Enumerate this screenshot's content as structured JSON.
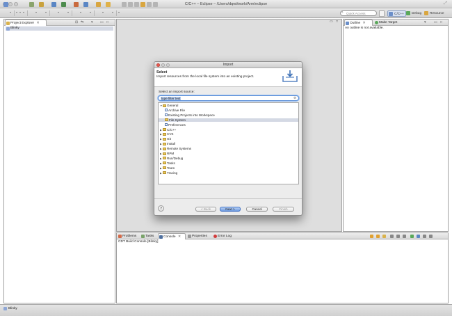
{
  "window": {
    "title": "C/C++ – Eclipse – /Users/dqwt/work/Arm/eclipse"
  },
  "toolbar": {
    "quick_access_placeholder": "Quick Access",
    "perspectives": [
      {
        "label": "C/C++",
        "active": true,
        "color": "#6b8fc9"
      },
      {
        "label": "Debug",
        "active": false,
        "color": "#5aa85a"
      },
      {
        "label": "Resource",
        "active": false,
        "color": "#d9a640"
      }
    ]
  },
  "project_explorer": {
    "tab_label": "Project Explorer",
    "items": [
      "Blinky"
    ]
  },
  "outline": {
    "tabs": [
      "Outline",
      "Make Target"
    ],
    "message": "An outline is not available."
  },
  "bottom_panel": {
    "tabs": [
      "Problems",
      "Tasks",
      "Console",
      "Properties",
      "Error Log"
    ],
    "console_title": "CDT Build Console [Blinky]"
  },
  "status_bar": {
    "text": "Blinky"
  },
  "dialog": {
    "title": "Import",
    "header_title": "Select",
    "header_desc": "Import resources from the local file system into an existing project.",
    "source_label": "Select an import source:",
    "filter_value": "type filter text",
    "tree": [
      {
        "label": "General",
        "level": 0,
        "expanded": true,
        "kind": "folder"
      },
      {
        "label": "Archive File",
        "level": 1,
        "kind": "item"
      },
      {
        "label": "Existing Projects into Workspace",
        "level": 1,
        "kind": "item"
      },
      {
        "label": "File System",
        "level": 1,
        "kind": "folder",
        "selected": true
      },
      {
        "label": "Preferences",
        "level": 1,
        "kind": "item"
      },
      {
        "label": "C/C++",
        "level": 0,
        "expanded": false,
        "kind": "folder"
      },
      {
        "label": "CVS",
        "level": 0,
        "expanded": false,
        "kind": "folder"
      },
      {
        "label": "Git",
        "level": 0,
        "expanded": false,
        "kind": "folder"
      },
      {
        "label": "Install",
        "level": 0,
        "expanded": false,
        "kind": "folder"
      },
      {
        "label": "Remote Systems",
        "level": 0,
        "expanded": false,
        "kind": "folder"
      },
      {
        "label": "RPM",
        "level": 0,
        "expanded": false,
        "kind": "folder"
      },
      {
        "label": "Run/Debug",
        "level": 0,
        "expanded": false,
        "kind": "folder"
      },
      {
        "label": "Tasks",
        "level": 0,
        "expanded": false,
        "kind": "folder"
      },
      {
        "label": "Team",
        "level": 0,
        "expanded": false,
        "kind": "folder"
      },
      {
        "label": "Tracing",
        "level": 0,
        "expanded": false,
        "kind": "folder"
      }
    ],
    "buttons": {
      "help": "?",
      "back": "< Back",
      "next": "Next >",
      "cancel": "Cancel",
      "finish": "Finish"
    }
  },
  "colors": {
    "accent": "#3b78d8",
    "selection": "#d4d9e4"
  }
}
